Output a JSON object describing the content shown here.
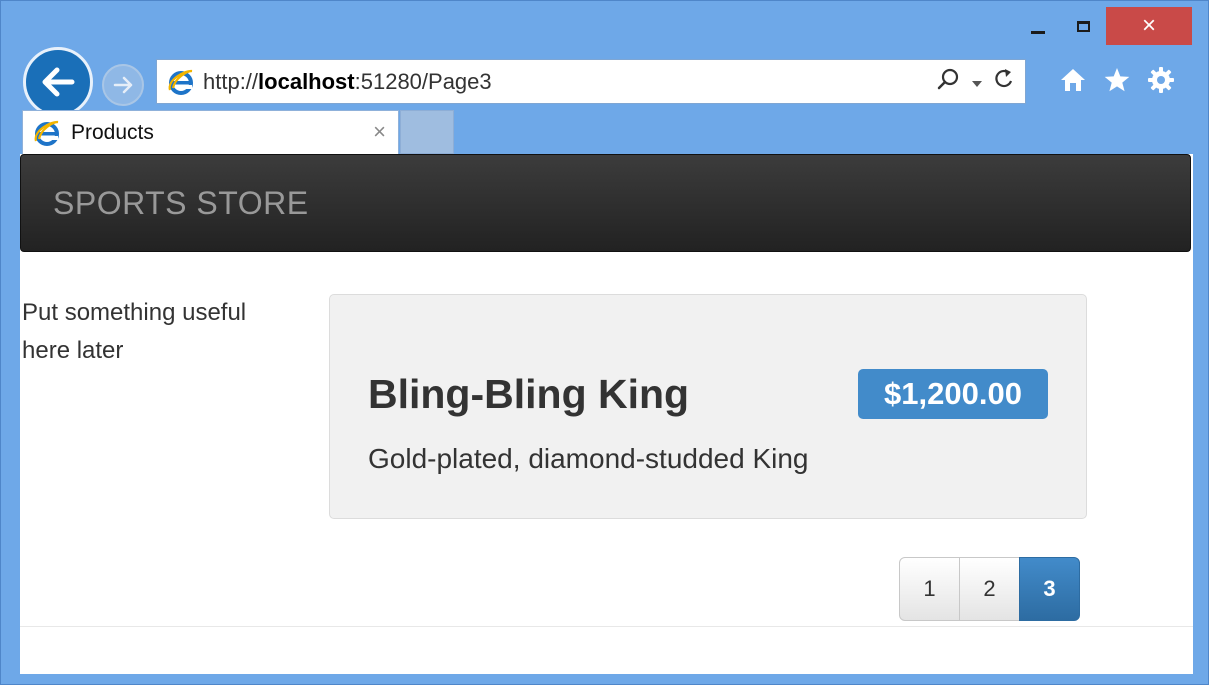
{
  "browser": {
    "address_url_prefix": "http://",
    "address_url_host": "localhost",
    "address_url_rest": ":51280/Page3",
    "tab_title": "Products",
    "tab_close_glyph": "×",
    "close_glyph": "×",
    "accent_color": "#6ea8e8",
    "icons": [
      "back-arrow-icon",
      "forward-arrow-icon",
      "ie-logo-icon",
      "search-icon",
      "dropdown-icon",
      "refresh-icon",
      "home-icon",
      "favorites-star-icon",
      "settings-gear-icon"
    ]
  },
  "site": {
    "brand": "SPORTS STORE",
    "sidebar_text": "Put something useful here later"
  },
  "product": {
    "name": "Bling-Bling King",
    "price": "$1,200.00",
    "description": "Gold-plated, diamond-studded King",
    "price_badge_color": "#428bca"
  },
  "pagination": {
    "pages": [
      "1",
      "2",
      "3"
    ],
    "current": "3"
  }
}
